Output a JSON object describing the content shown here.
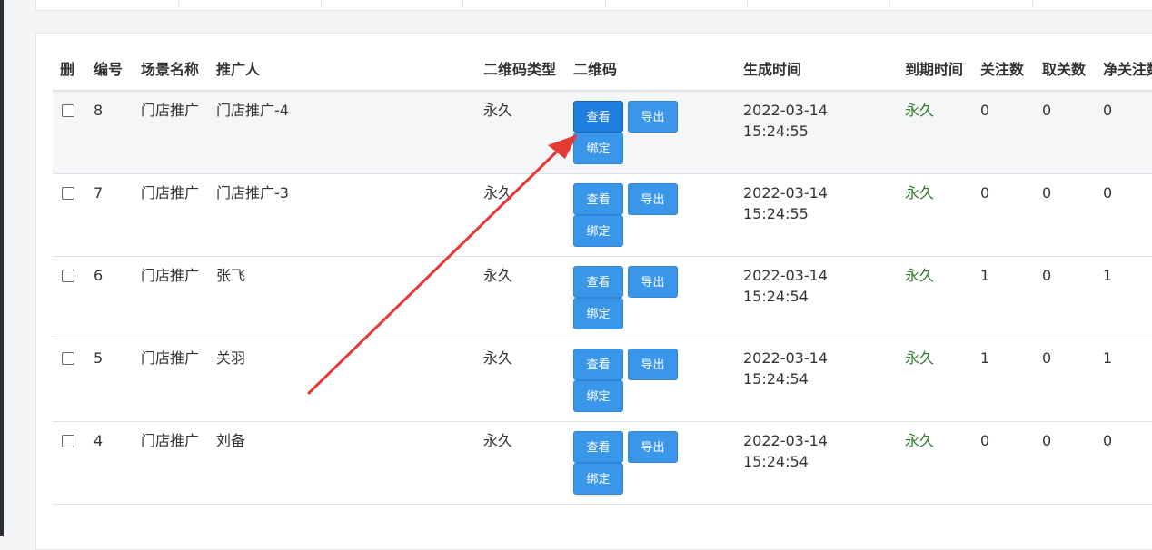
{
  "table": {
    "headers": {
      "del": "删",
      "id": "编号",
      "scene": "场景名称",
      "promoter": "推广人",
      "qr_type": "二维码类型",
      "qrcode": "二维码",
      "created": "生成时间",
      "expires": "到期时间",
      "follow": "关注数",
      "unfollow": "取关数",
      "net": "净关注数"
    },
    "rows": [
      {
        "id": "8",
        "scene": "门店推广",
        "promoter": "门店推广-4",
        "qr_type": "永久",
        "created": "2022-03-14 15:24:55",
        "expires": "永久",
        "follow": "0",
        "unfollow": "0",
        "net": "0"
      },
      {
        "id": "7",
        "scene": "门店推广",
        "promoter": "门店推广-3",
        "qr_type": "永久",
        "created": "2022-03-14 15:24:55",
        "expires": "永久",
        "follow": "0",
        "unfollow": "0",
        "net": "0"
      },
      {
        "id": "6",
        "scene": "门店推广",
        "promoter": "张飞",
        "qr_type": "永久",
        "created": "2022-03-14 15:24:54",
        "expires": "永久",
        "follow": "1",
        "unfollow": "0",
        "net": "1"
      },
      {
        "id": "5",
        "scene": "门店推广",
        "promoter": "关羽",
        "qr_type": "永久",
        "created": "2022-03-14 15:24:54",
        "expires": "永久",
        "follow": "1",
        "unfollow": "0",
        "net": "1"
      },
      {
        "id": "4",
        "scene": "门店推广",
        "promoter": "刘备",
        "qr_type": "永久",
        "created": "2022-03-14 15:24:54",
        "expires": "永久",
        "follow": "0",
        "unfollow": "0",
        "net": "0"
      }
    ],
    "actions": {
      "view": "查看",
      "export": "导出",
      "bind": "绑定"
    }
  },
  "colors": {
    "accent": "#3a96e8",
    "annotation_arrow": "#e53935",
    "expire_text": "#2f7d2f"
  }
}
